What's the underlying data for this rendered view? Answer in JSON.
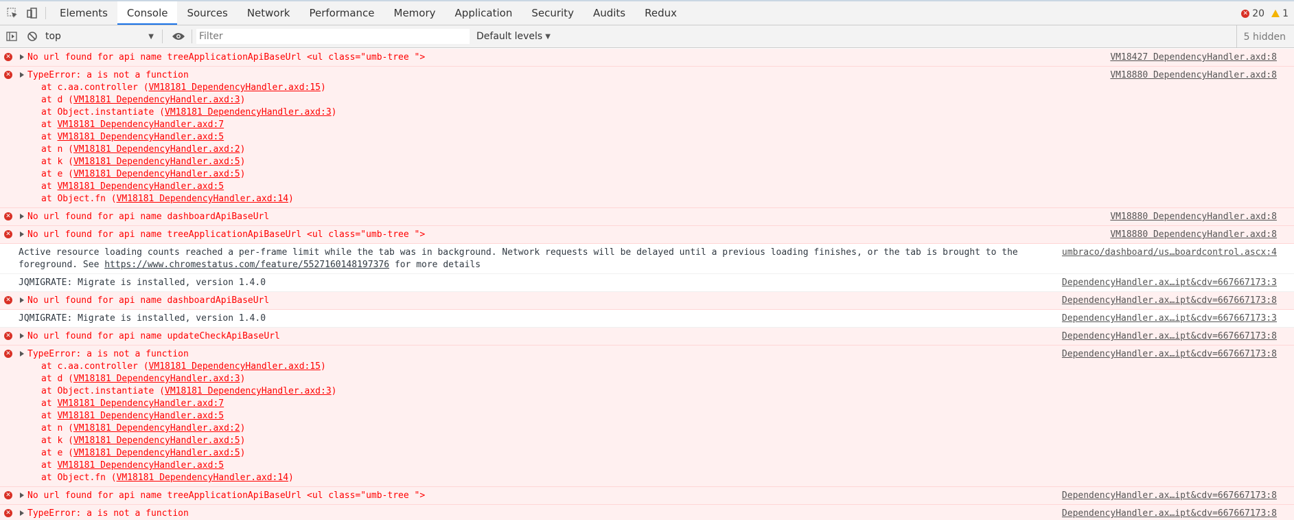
{
  "tabs": [
    {
      "label": "Elements"
    },
    {
      "label": "Console",
      "selected": true
    },
    {
      "label": "Sources"
    },
    {
      "label": "Network"
    },
    {
      "label": "Performance"
    },
    {
      "label": "Memory"
    },
    {
      "label": "Application"
    },
    {
      "label": "Security"
    },
    {
      "label": "Audits"
    },
    {
      "label": "Redux"
    }
  ],
  "counts": {
    "errors": "20",
    "warnings": "1"
  },
  "toolbar": {
    "context": "top",
    "filter_placeholder": "Filter",
    "levels": "Default levels",
    "hidden": "5 hidden"
  },
  "messages": [
    {
      "type": "error",
      "text": "No url found for api name treeApplicationApiBaseUrl <ul class=\"umb-tree \">",
      "source": "VM18427 DependencyHandler.axd:8"
    },
    {
      "type": "error",
      "text": "TypeError: a is not a function",
      "source": "VM18880 DependencyHandler.axd:8",
      "stack": [
        {
          "pre": "at c.aa.controller (",
          "link": "VM18181 DependencyHandler.axd:15",
          "post": ")"
        },
        {
          "pre": "at d (",
          "link": "VM18181 DependencyHandler.axd:3",
          "post": ")"
        },
        {
          "pre": "at Object.instantiate (",
          "link": "VM18181 DependencyHandler.axd:3",
          "post": ")"
        },
        {
          "pre": "at ",
          "link": "VM18181 DependencyHandler.axd:7",
          "post": ""
        },
        {
          "pre": "at ",
          "link": "VM18181 DependencyHandler.axd:5",
          "post": ""
        },
        {
          "pre": "at n (",
          "link": "VM18181 DependencyHandler.axd:2",
          "post": ")"
        },
        {
          "pre": "at k (",
          "link": "VM18181 DependencyHandler.axd:5",
          "post": ")"
        },
        {
          "pre": "at e (",
          "link": "VM18181 DependencyHandler.axd:5",
          "post": ")"
        },
        {
          "pre": "at ",
          "link": "VM18181 DependencyHandler.axd:5",
          "post": ""
        },
        {
          "pre": "at Object.fn (",
          "link": "VM18181 DependencyHandler.axd:14",
          "post": ")"
        }
      ]
    },
    {
      "type": "error",
      "text": "No url found for api name dashboardApiBaseUrl",
      "source": "VM18880 DependencyHandler.axd:8"
    },
    {
      "type": "error",
      "text": "No url found for api name treeApplicationApiBaseUrl <ul class=\"umb-tree \">",
      "source": "VM18880 DependencyHandler.axd:8"
    },
    {
      "type": "info",
      "text": "Active resource loading counts reached a per-frame limit while the tab was in background. Network requests will be delayed until a previous loading finishes, or the tab is brought to the foreground. See ",
      "link": "https://www.chromestatus.com/feature/5527160148197376",
      "post": " for more details",
      "source": "umbraco/dashboard/us…boardcontrol.ascx:4"
    },
    {
      "type": "info",
      "text": "JQMIGRATE: Migrate is installed, version 1.4.0",
      "source": "DependencyHandler.ax…ipt&cdv=667667173:3"
    },
    {
      "type": "error",
      "text": "No url found for api name dashboardApiBaseUrl",
      "source": "DependencyHandler.ax…ipt&cdv=667667173:8"
    },
    {
      "type": "info",
      "text": "JQMIGRATE: Migrate is installed, version 1.4.0",
      "source": "DependencyHandler.ax…ipt&cdv=667667173:3"
    },
    {
      "type": "error",
      "text": "No url found for api name updateCheckApiBaseUrl",
      "source": "DependencyHandler.ax…ipt&cdv=667667173:8"
    },
    {
      "type": "error",
      "text": "TypeError: a is not a function",
      "source": "DependencyHandler.ax…ipt&cdv=667667173:8",
      "stack": [
        {
          "pre": "at c.aa.controller (",
          "link": "VM18181 DependencyHandler.axd:15",
          "post": ")"
        },
        {
          "pre": "at d (",
          "link": "VM18181 DependencyHandler.axd:3",
          "post": ")"
        },
        {
          "pre": "at Object.instantiate (",
          "link": "VM18181 DependencyHandler.axd:3",
          "post": ")"
        },
        {
          "pre": "at ",
          "link": "VM18181 DependencyHandler.axd:7",
          "post": ""
        },
        {
          "pre": "at ",
          "link": "VM18181 DependencyHandler.axd:5",
          "post": ""
        },
        {
          "pre": "at n (",
          "link": "VM18181 DependencyHandler.axd:2",
          "post": ")"
        },
        {
          "pre": "at k (",
          "link": "VM18181 DependencyHandler.axd:5",
          "post": ")"
        },
        {
          "pre": "at e (",
          "link": "VM18181 DependencyHandler.axd:5",
          "post": ")"
        },
        {
          "pre": "at ",
          "link": "VM18181 DependencyHandler.axd:5",
          "post": ""
        },
        {
          "pre": "at Object.fn (",
          "link": "VM18181 DependencyHandler.axd:14",
          "post": ")"
        }
      ]
    },
    {
      "type": "error",
      "text": "No url found for api name treeApplicationApiBaseUrl <ul class=\"umb-tree \">",
      "source": "DependencyHandler.ax…ipt&cdv=667667173:8"
    },
    {
      "type": "error",
      "text": "TypeError: a is not a function",
      "source": "DependencyHandler.ax…ipt&cdv=667667173:8"
    }
  ]
}
